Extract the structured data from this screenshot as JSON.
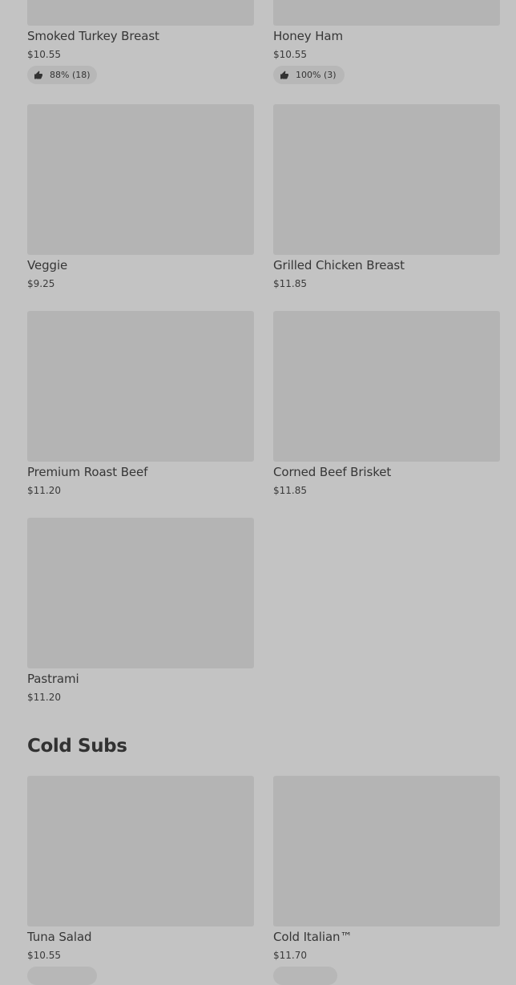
{
  "sections": {
    "hot_items": [
      {
        "name": "Smoked Turkey Breast",
        "price": "$10.55",
        "rating": "88% (18)"
      },
      {
        "name": "Honey Ham",
        "price": "$10.55",
        "rating": "100% (3)"
      },
      {
        "name": "Veggie",
        "price": "$9.25"
      },
      {
        "name": "Grilled Chicken Breast",
        "price": "$11.85"
      },
      {
        "name": "Premium Roast Beef",
        "price": "$11.20"
      },
      {
        "name": "Corned Beef Brisket",
        "price": "$11.85"
      },
      {
        "name": "Pastrami",
        "price": "$11.20"
      }
    ],
    "cold_subs": {
      "title": "Cold Subs",
      "items": [
        {
          "name": "Tuna Salad",
          "price": "$10.55"
        },
        {
          "name": "Cold Italian™",
          "price": "$11.70"
        }
      ]
    }
  },
  "icons": {
    "rating": "thumbs-up-icon"
  },
  "colors": {
    "background": "#c3c3c3",
    "image_placeholder": "#b4b4b4",
    "rating_pill": "#b7b7b7"
  }
}
